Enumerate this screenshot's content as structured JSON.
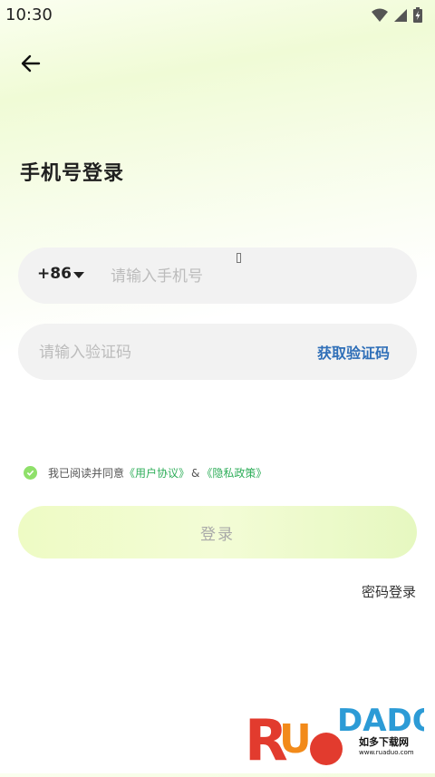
{
  "status_bar": {
    "time": "10:30",
    "icons": [
      "wifi-icon",
      "signal-icon",
      "battery-icon"
    ]
  },
  "header": {
    "back_icon": "arrow-left-icon",
    "title": "手机号登录"
  },
  "phone": {
    "country_code": "+86",
    "placeholder": "请输入手机号",
    "value": ""
  },
  "code": {
    "placeholder": "请输入验证码",
    "value": "",
    "get_code_label": "获取验证码"
  },
  "agreement": {
    "checked": true,
    "prefix": "我已阅读并同意",
    "user_agreement": "《用户协议》",
    "separator": "&",
    "privacy_policy": "《隐私政策》"
  },
  "login_button_label": "登录",
  "password_login_label": "密码登录",
  "watermark": {
    "logo_text": "RUANDUO",
    "subtitle": "如多下载网",
    "url": "www.ruaduo.com"
  },
  "colors": {
    "accent_green": "#8fe06a",
    "link_green": "#2fae5a",
    "link_blue": "#2f6fb8",
    "field_bg": "#f2f2f2"
  }
}
